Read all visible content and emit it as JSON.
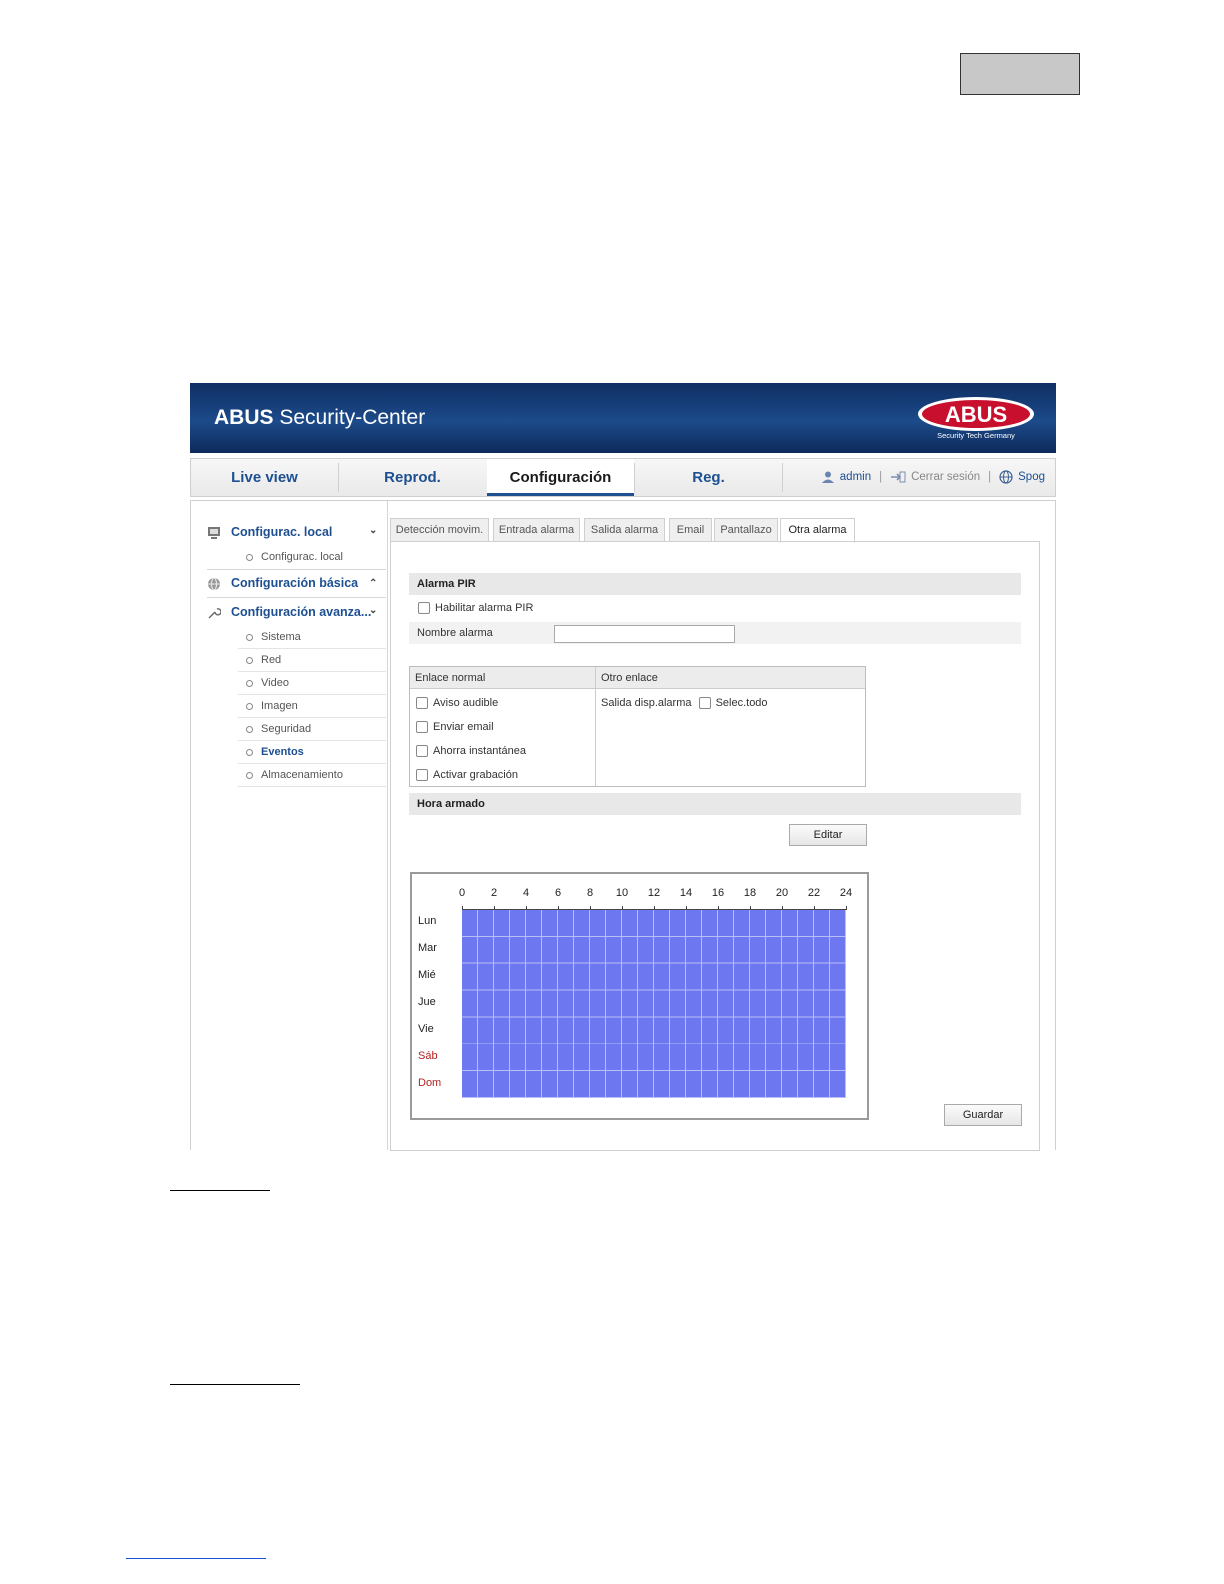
{
  "app": {
    "title_bold": "ABUS",
    "title_rest": " Security-Center",
    "logo_text": "ABUS",
    "logo_tagline": "Security Tech Germany"
  },
  "nav": {
    "tabs": [
      {
        "label": "Live view",
        "active": false
      },
      {
        "label": "Reprod.",
        "active": false
      },
      {
        "label": "Configuración",
        "active": true
      },
      {
        "label": "Reg.",
        "active": false
      }
    ],
    "user": "admin",
    "logout": "Cerrar sesión",
    "language": "Spog"
  },
  "sidebar": {
    "groups": [
      {
        "label": "Configurac. local",
        "icon": "monitor-icon",
        "items": [
          "Configurac. local"
        ]
      },
      {
        "label": "Configuración básica",
        "icon": "globe-icon",
        "items": []
      },
      {
        "label": "Configuración avanza...",
        "icon": "wrench-icon",
        "items": [
          "Sistema",
          "Red",
          "Video",
          "Imagen",
          "Seguridad",
          "Eventos",
          "Almacenamiento"
        ]
      }
    ],
    "active_item": "Eventos"
  },
  "subtabs": [
    "Detección movim.",
    "Entrada alarma",
    "Salida alarma",
    "Email",
    "Pantallazo",
    "Otra alarma"
  ],
  "active_subtab": "Otra alarma",
  "form": {
    "section_pir": "Alarma PIR",
    "enable_label": "Habilitar alarma PIR",
    "name_label": "Nombre alarma",
    "name_value": "",
    "normal_link_header": "Enlace normal",
    "other_link_header": "Otro enlace",
    "normal_options": [
      "Aviso audible",
      "Enviar email",
      "Ahorra instantánea",
      "Activar grabación"
    ],
    "other_output_label": "Salida disp.alarma",
    "select_all_label": "Selec.todo",
    "section_schedule": "Hora armado",
    "edit_button": "Editar",
    "save_button": "Guardar"
  },
  "schedule": {
    "hours": [
      "0",
      "2",
      "4",
      "6",
      "8",
      "10",
      "12",
      "14",
      "16",
      "18",
      "20",
      "22",
      "24"
    ],
    "days": [
      {
        "label": "Lun",
        "weekend": false
      },
      {
        "label": "Mar",
        "weekend": false
      },
      {
        "label": "Mié",
        "weekend": false
      },
      {
        "label": "Jue",
        "weekend": false
      },
      {
        "label": "Vie",
        "weekend": false
      },
      {
        "label": "Sáb",
        "weekend": true
      },
      {
        "label": "Dom",
        "weekend": true
      }
    ],
    "armed_color": "#6c77f0",
    "armed_all_week": true
  }
}
